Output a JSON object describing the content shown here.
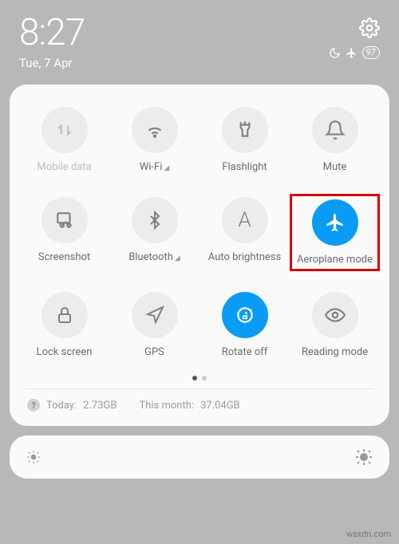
{
  "header": {
    "time": "8:27",
    "date": "Tue, 7 Apr",
    "battery": "97"
  },
  "tiles": {
    "mobile_data": {
      "label": "Mobile data",
      "state": "disabled"
    },
    "wifi": {
      "label": "Wi-Fi"
    },
    "flashlight": {
      "label": "Flashlight"
    },
    "mute": {
      "label": "Mute"
    },
    "screenshot": {
      "label": "Screenshot"
    },
    "bluetooth": {
      "label": "Bluetooth"
    },
    "auto_brightness": {
      "label": "Auto brightness"
    },
    "aeroplane": {
      "label": "Aeroplane mode",
      "state": "active"
    },
    "lock_screen": {
      "label": "Lock screen"
    },
    "gps": {
      "label": "GPS"
    },
    "rotate": {
      "label": "Rotate off",
      "state": "active"
    },
    "reading": {
      "label": "Reading mode"
    }
  },
  "usage": {
    "today_label": "Today:",
    "today_value": "2.73GB",
    "month_label": "This month:",
    "month_value": "37.04GB"
  },
  "watermark": "wsxdn.com"
}
